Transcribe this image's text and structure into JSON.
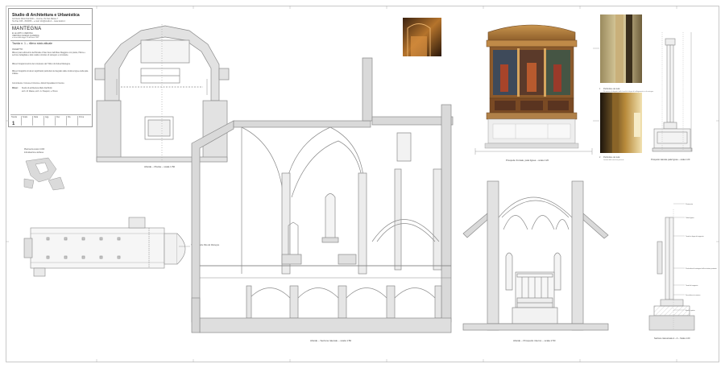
{
  "title_block": {
    "firm": "Studio di Architettura e Urbanistica",
    "address_lines": [
      "Architetto Mario Dal Molin – Verona, Via San Matteo 7",
      "Tel./Fax 045 – 8034/56 – e-mail: info@studio.it – www.studio.it"
    ],
    "project": "MANTEGNA",
    "subtitle_lines": [
      "E LE ARTI A VERONA",
      "VERONA CHIESA GUARDIA",
      "ai sensi della legge 15 dell'anno 1987"
    ],
    "sheet_title": "Tavola n. 1 – rilievo stato attuale",
    "section_heading": "OGGETTO:",
    "bullets": [
      "Rilievo piano altimetrico dell'Abside di San Zeno dell'Altare Maggiore con pianta, Pittore e sezione dettagliata e delle relative strutture di sostegno e retrostante.",
      "Rilievo fotogrammetrico del complesso del Trittico di Andrea Mantegna.",
      "Rilievo fotografico di alcuni significativi particolari del degrado delle strutture lignee della pala d'altare."
    ],
    "client_line": "Committente: Comune di Verona e Istituti Ospedalieri di Verona",
    "credit_label": "Rilievi:",
    "credit_lines": [
      "Studio di architettura Mario Dal Molin",
      "arch. M. Massa, arch. G. Pasquini, e. Bruno"
    ],
    "grid_cells": [
      "Tavola",
      "Scala",
      "Data",
      "Agg.",
      "Rev.",
      "Dis.",
      "Firma"
    ],
    "sheet_number": "1"
  },
  "captions": {
    "plan": "Abside – Pianta – scala 1:50",
    "section": "Abside – Sezione laterale – scala 1:50",
    "front_elev": "Prospetto frontale, pala lignea – scala 1:20",
    "side_elev": "Prospetto laterale pala lignea – scala 1:20",
    "interior_elev": "Abside – Prospetto interno – scala 1:50",
    "detail_section": "Sezione trasversale A – A – Scala 1:20",
    "key_plan": "Planimetria scala 1:1000",
    "key_plan_sub": "Individuazione dell'area",
    "church_plan_note": "Tribuna Abside Pala del Mantegna"
  },
  "photo_notes": {
    "photo1_num": "1",
    "photo1_text": "Particolare dei telai",
    "photo1_sub": "Situazione di degrado delle lamelle di legno di collegamento e di sostegno",
    "photo2_num": "2",
    "photo2_text": "Particolare dei telai",
    "photo2_sub": "Lesioni della struttura portante"
  },
  "detail_notes": [
    "Pavimento",
    "Telaio ligneo",
    "Tavola in legno di supporto",
    "Particolare di sostegno della struttura portante",
    "Tavola di supporto",
    "Zoccolatura in marmo",
    "Base in pietra"
  ],
  "colors": {
    "line": "#9a9a9a",
    "dark_line": "#6e6e6e",
    "fill_grey": "#dcdcdc",
    "frame_gold": "#b8864a",
    "wood_red": "#a8442a"
  }
}
